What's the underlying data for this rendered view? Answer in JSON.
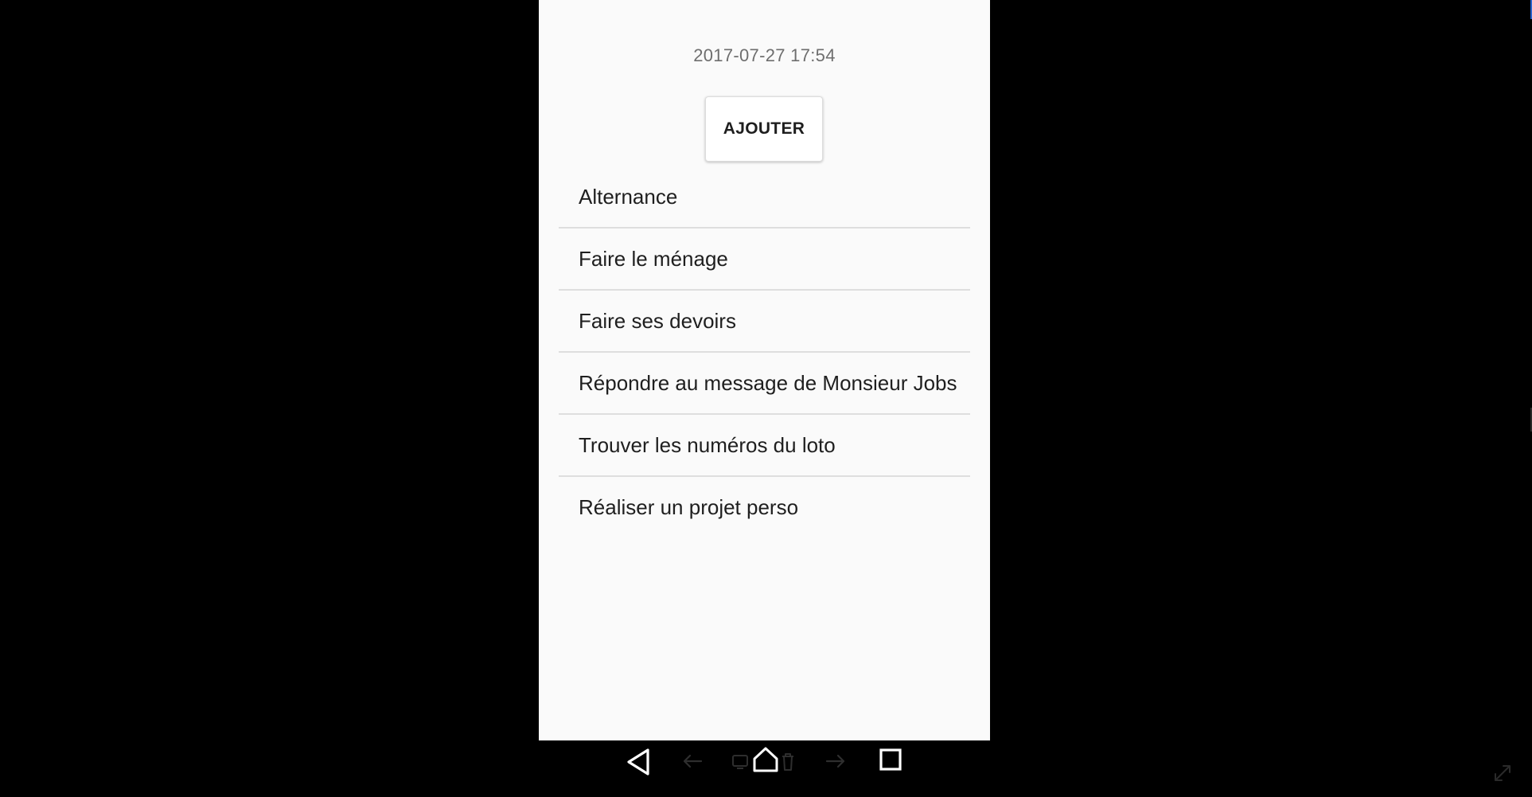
{
  "timestamp": "2017-07-27 17:54",
  "add_button": {
    "label": "AJOUTER"
  },
  "tasks": [
    {
      "label": "Alternance"
    },
    {
      "label": "Faire le ménage"
    },
    {
      "label": "Faire ses devoirs"
    },
    {
      "label": "Répondre au message de Monsieur Jobs"
    },
    {
      "label": "Trouver les numéros du loto"
    },
    {
      "label": "Réaliser un projet perso"
    }
  ],
  "navbar": {
    "icons": [
      "back-icon",
      "arrow-left-icon",
      "screenshot-icon",
      "home-icon",
      "trash-icon",
      "arrow-right-icon",
      "recents-icon",
      "fullscreen-icon"
    ]
  },
  "colors": {
    "background": "#000000",
    "screen": "#fafafa",
    "divider": "#dedede",
    "accent": "#2a62c9"
  }
}
